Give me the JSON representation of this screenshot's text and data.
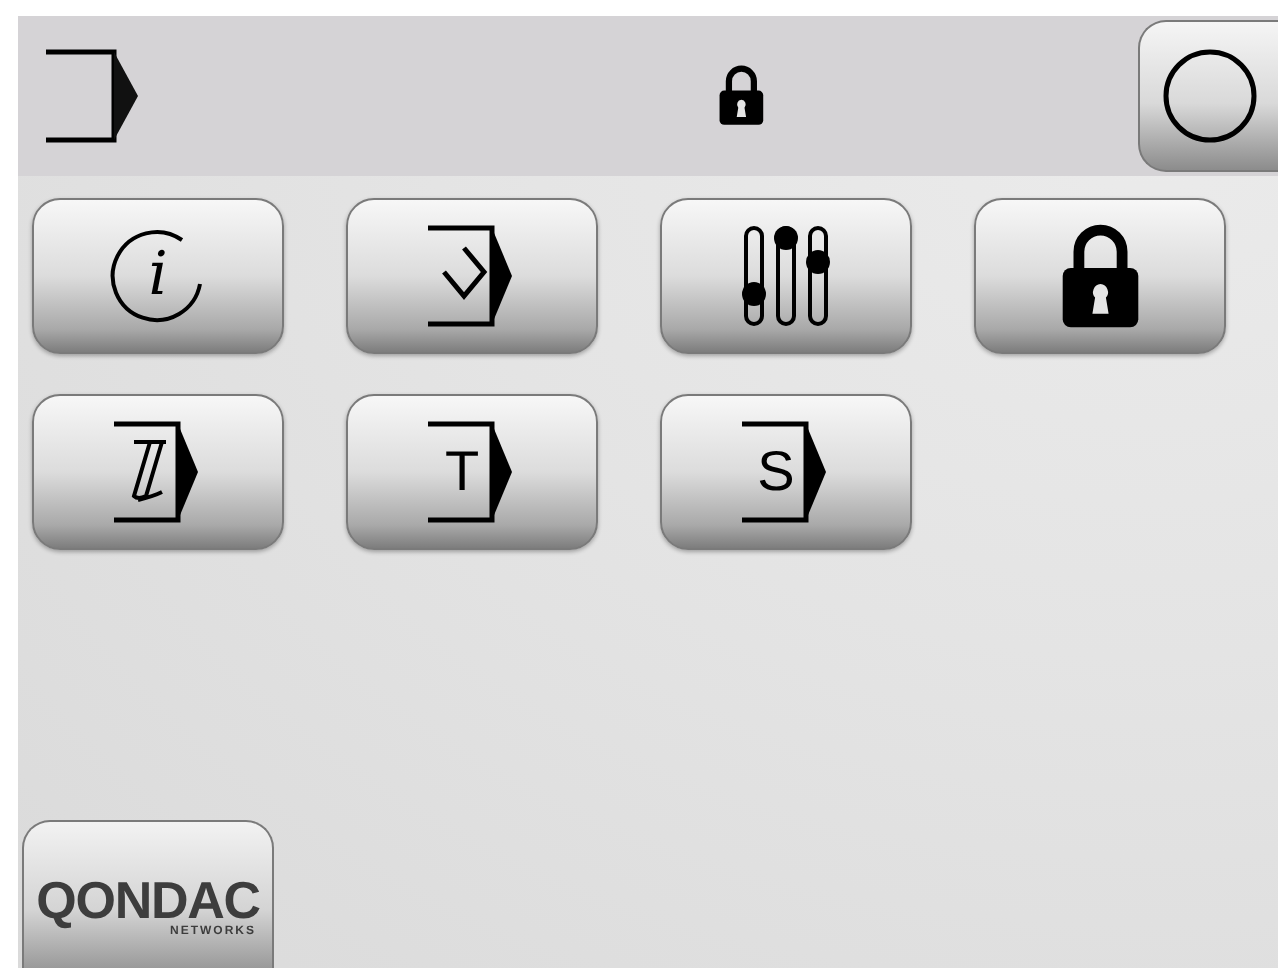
{
  "top_bar": {
    "items": [
      {
        "kind": "exit"
      },
      {
        "kind": "lock"
      },
      {
        "kind": "circle"
      }
    ]
  },
  "buttons": [
    {
      "kind": "info",
      "label": "i"
    },
    {
      "kind": "diamond"
    },
    {
      "kind": "sliders"
    },
    {
      "kind": "lock"
    },
    {
      "kind": "z"
    },
    {
      "kind": "letter",
      "label": "T"
    },
    {
      "kind": "letter",
      "label": "S"
    }
  ],
  "logo": {
    "title": "QONDAC",
    "subtitle": "NETWORKS"
  }
}
